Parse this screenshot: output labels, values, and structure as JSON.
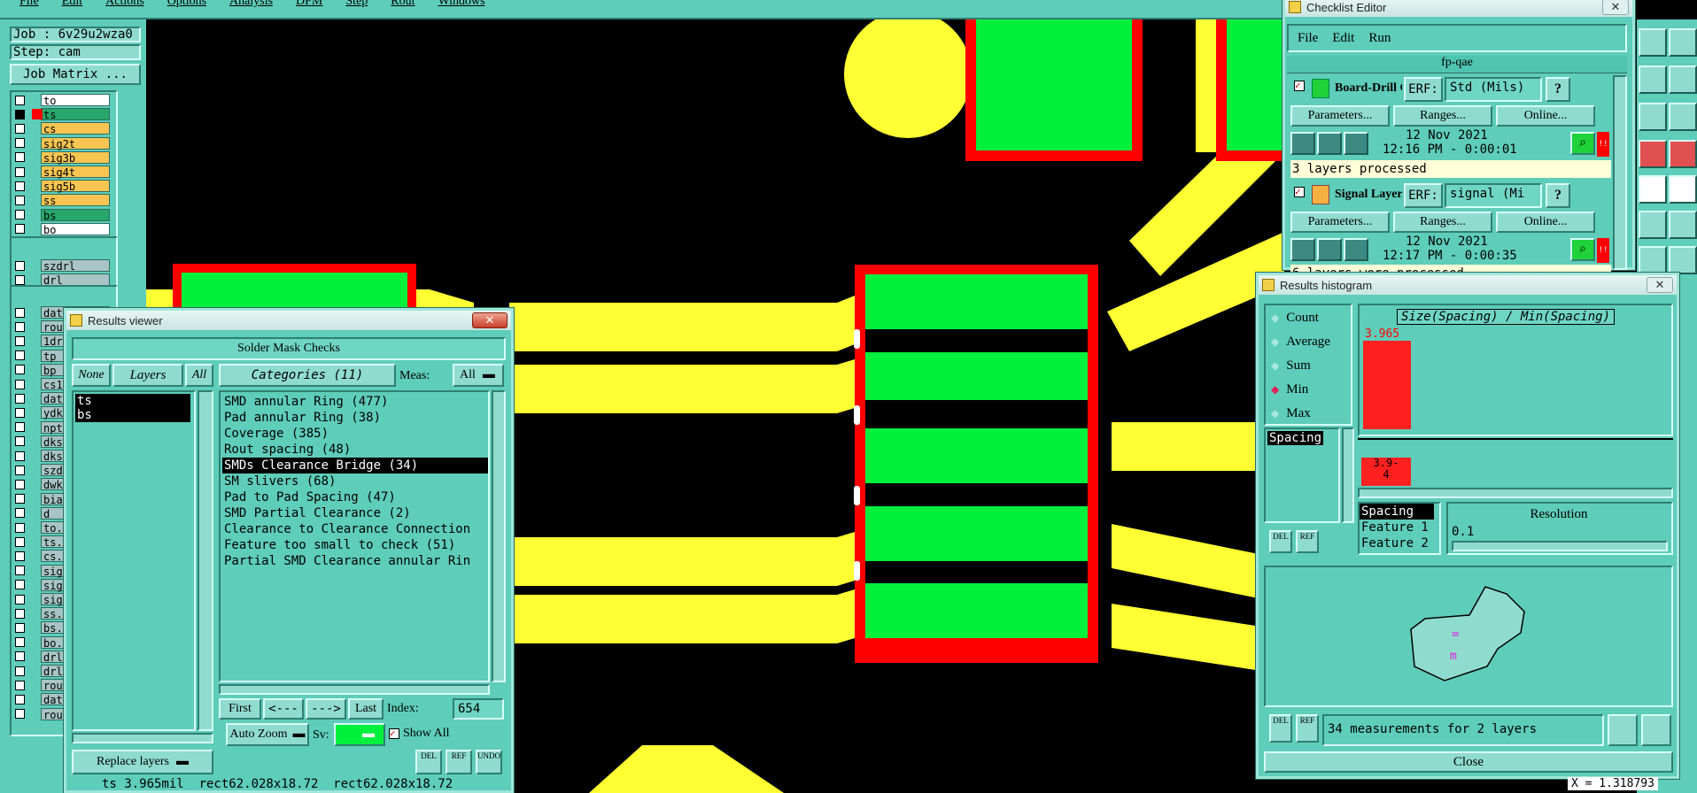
{
  "menu": {
    "items": [
      "File",
      "Edit",
      "Actions",
      "Options",
      "Analysis",
      "DFM",
      "Step",
      "Rout",
      "Windows"
    ]
  },
  "job": {
    "job_label": "Job : 6v29u2wza0",
    "step_label": "Step: cam",
    "matrix_button": "Job Matrix ..."
  },
  "layers": {
    "group1": [
      {
        "name": "to",
        "color": "#ffffff"
      },
      {
        "name": "ts",
        "color": "#27a86a",
        "selected": true
      },
      {
        "name": "cs",
        "color": "#f9c552"
      },
      {
        "name": "sig2t",
        "color": "#f9c552"
      },
      {
        "name": "sig3b",
        "color": "#f9c552"
      },
      {
        "name": "sig4t",
        "color": "#f9c552"
      },
      {
        "name": "sig5b",
        "color": "#f9c552"
      },
      {
        "name": "ss",
        "color": "#f9c552"
      },
      {
        "name": "bs",
        "color": "#27a86a"
      },
      {
        "name": "bo",
        "color": "#ffffff"
      }
    ],
    "group2": [
      {
        "name": "szdrl"
      },
      {
        "name": "drl"
      },
      {
        "name": "rout"
      }
    ],
    "group3": [
      {
        "name": "date_number"
      },
      {
        "name": "rou"
      },
      {
        "name": "1dr"
      },
      {
        "name": "tp"
      },
      {
        "name": "bp"
      },
      {
        "name": "cs1"
      },
      {
        "name": "dat"
      },
      {
        "name": "ydk"
      },
      {
        "name": "npt"
      },
      {
        "name": "dks"
      },
      {
        "name": "dks"
      },
      {
        "name": "szd"
      },
      {
        "name": "dwk"
      },
      {
        "name": "bia"
      },
      {
        "name": "d"
      },
      {
        "name": "to."
      },
      {
        "name": "ts."
      },
      {
        "name": "cs."
      },
      {
        "name": "sig"
      },
      {
        "name": "sig"
      },
      {
        "name": "sig"
      },
      {
        "name": "ss."
      },
      {
        "name": "bs."
      },
      {
        "name": "bo."
      },
      {
        "name": "drl"
      },
      {
        "name": "drl"
      },
      {
        "name": "rou"
      },
      {
        "name": "dat"
      },
      {
        "name": "rou"
      }
    ]
  },
  "results_viewer": {
    "title": "Results viewer",
    "header": "Solder Mask Checks",
    "none_label": "None",
    "layers_label": "Layers",
    "all_label": "All",
    "categories_label": "Categories (11)",
    "meas_label": "Meas:",
    "meas_value": "All",
    "layer_list": [
      "ts",
      "bs"
    ],
    "categories": [
      "SMD annular Ring (477)",
      "Pad annular Ring (38)",
      "Coverage (385)",
      "Rout spacing (48)",
      "SMDs Clearance Bridge (34)",
      "SM slivers (68)",
      "Pad to Pad Spacing (47)",
      "SMD Partial Clearance (2)",
      "Clearance to Clearance Connection",
      "Feature too small to check (51)",
      "Partial SMD Clearance annular Rin"
    ],
    "selected_index": 4,
    "first": "First",
    "prev": "<---",
    "next": "--->",
    "last": "Last",
    "index_label": "Index:",
    "index_value": "654",
    "auto_zoom": "Auto Zoom",
    "sv_label": "Sv:",
    "show_all": "Show All",
    "replace_layers": "Replace layers",
    "del": "DEL",
    "ref": "REF",
    "undo": "UNDO",
    "status": "ts 3.965mil  rect62.028x18.72  rect62.028x18.72"
  },
  "checklist_editor": {
    "title": "Checklist Editor",
    "menu": [
      "File",
      "Edit",
      "Run"
    ],
    "checklist_name": "fp-qae",
    "check1": {
      "name": "Board-Drill Che",
      "erf": "ERF:",
      "erf_value": "Std (Mils)",
      "params": "Parameters...",
      "ranges": "Ranges...",
      "online": "Online...",
      "date": "12 Nov 2021",
      "time": "12:16 PM - 0:00:01",
      "status": "3 layers processed"
    },
    "check2": {
      "name": "Signal Layer Ch",
      "erf": "ERF:",
      "erf_value": "signal (Mi",
      "params": "Parameters...",
      "ranges": "Ranges...",
      "online": "Online...",
      "date": "12 Nov 2021",
      "time": "12:17 PM - 0:00:35",
      "status": "6 layers were processed"
    },
    "help": "?",
    "flag": "!!"
  },
  "histogram": {
    "title": "Results histogram",
    "modes": [
      "Count",
      "Average",
      "Sum",
      "Min",
      "Max"
    ],
    "mode_selected": "Min",
    "graph_title": "Size(Spacing) / Min(Spacing)",
    "list_item": "Spacing",
    "resolution_label": "Resolution",
    "resolution_value": "0.1",
    "fields": [
      "Spacing",
      "Feature 1",
      "Feature 2"
    ],
    "summary": "34 measurements for 2 layers",
    "close": "Close",
    "del": "DEL",
    "ref": "REF"
  },
  "chart_data": {
    "type": "bar",
    "title": "Size(Spacing) / Min(Spacing)",
    "categories": [
      "3.9-4"
    ],
    "values": [
      3.965
    ],
    "value_label": "3.965",
    "bin_label": "3.9-\n4"
  },
  "coords": {
    "x": "X = 1.318793"
  },
  "colors": {
    "panel": "#5ecdb9",
    "copper": "#ffff33",
    "pad": "#00f03c",
    "mask": "#ff0000"
  }
}
